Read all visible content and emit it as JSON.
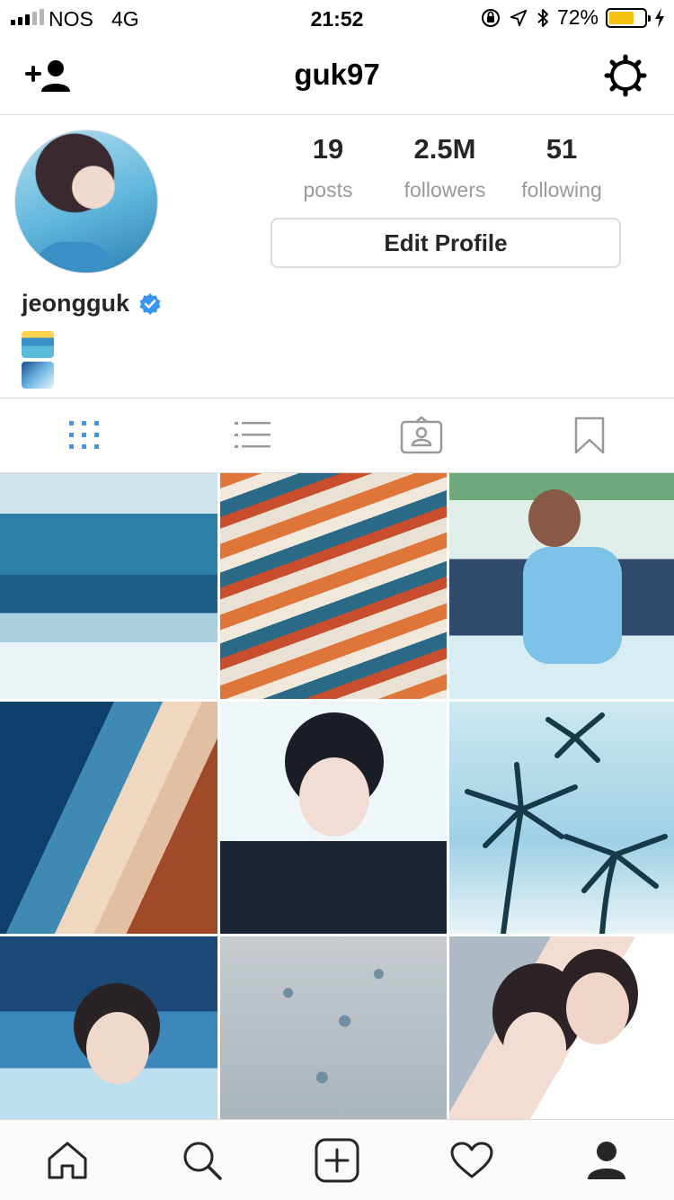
{
  "status_bar": {
    "carrier": "NOS",
    "network": "4G",
    "time": "21:52",
    "battery_percent": "72%",
    "battery_level": 0.72,
    "battery_color": "#f4c20f"
  },
  "nav": {
    "title": "guk97",
    "left_icon": "add-person-icon",
    "right_icon": "settings-gear-icon"
  },
  "profile": {
    "stats": [
      {
        "value": "19",
        "label": "posts"
      },
      {
        "value": "2.5M",
        "label": "followers"
      },
      {
        "value": "51",
        "label": "following"
      }
    ],
    "edit_button": "Edit Profile",
    "display_name": "jeongguk",
    "verified_color": "#3897f0",
    "bio_emojis": [
      "surfer-emoji",
      "water-wave-emoji"
    ]
  },
  "tabs": [
    {
      "name": "grid-view-icon",
      "active": true
    },
    {
      "name": "list-view-icon",
      "active": false
    },
    {
      "name": "tagged-photos-icon",
      "active": false
    },
    {
      "name": "saved-bookmark-icon",
      "active": false
    }
  ],
  "grid": {
    "photos": [
      "surfer-wave",
      "surfboards-shop",
      "boy-on-beach-chair",
      "coastline-aerial",
      "boy-in-suit",
      "palm-trees",
      "boy-raising-hand",
      "baby-turtles",
      "selfie-couple"
    ]
  },
  "bottom_nav": [
    {
      "name": "home-icon"
    },
    {
      "name": "search-icon"
    },
    {
      "name": "new-post-icon"
    },
    {
      "name": "activity-heart-icon"
    },
    {
      "name": "profile-icon",
      "active": true
    }
  ],
  "colors": {
    "accent": "#3897f0",
    "inactive_icon": "#999999"
  }
}
